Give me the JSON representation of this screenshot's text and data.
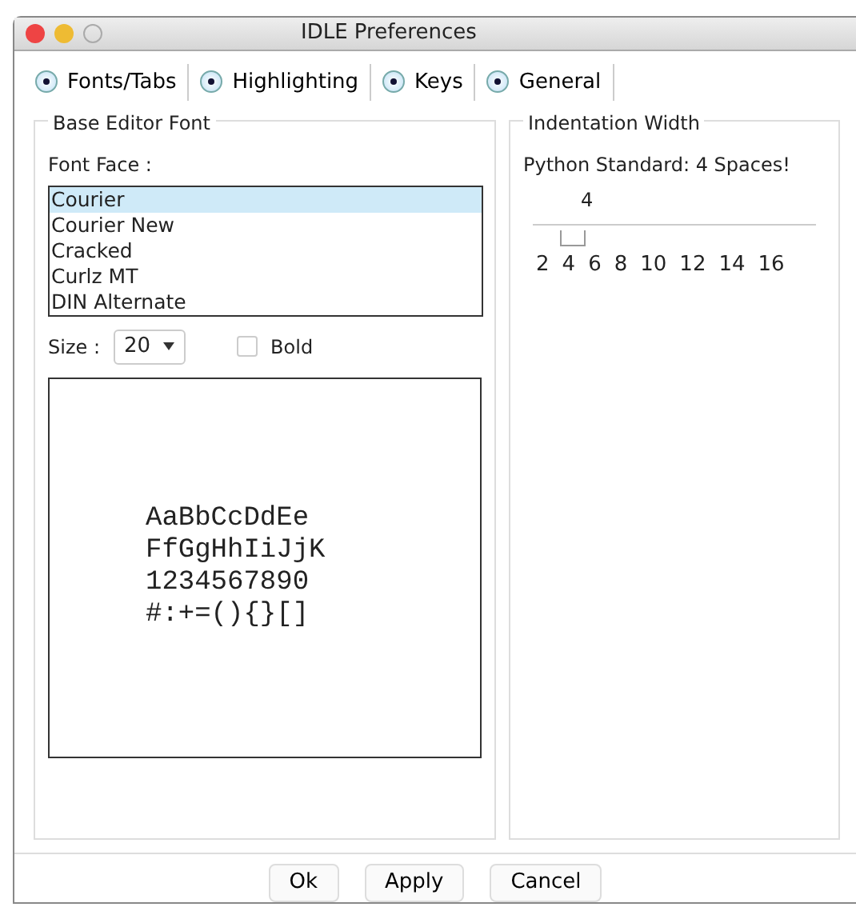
{
  "window": {
    "title": "IDLE Preferences"
  },
  "tabs": [
    {
      "label": "Fonts/Tabs",
      "checked": true
    },
    {
      "label": "Highlighting",
      "checked": true
    },
    {
      "label": "Keys",
      "checked": true
    },
    {
      "label": "General",
      "checked": true
    }
  ],
  "base_editor_font": {
    "title": "Base Editor Font",
    "font_face_label": "Font Face :",
    "fonts": [
      {
        "name": "Courier",
        "selected": true
      },
      {
        "name": "Courier New",
        "selected": false
      },
      {
        "name": "Cracked",
        "selected": false
      },
      {
        "name": "Curlz MT",
        "selected": false
      },
      {
        "name": "DIN Alternate",
        "selected": false
      }
    ],
    "size_label": "Size :",
    "size_value": "20",
    "bold": {
      "label": "Bold",
      "checked": false
    },
    "preview_lines": [
      "AaBbCcDdEe",
      "FfGgHhIiJjK",
      "1234567890",
      "#:+=(){}[]"
    ]
  },
  "indentation_width": {
    "title": "Indentation Width",
    "note": "Python Standard: 4 Spaces!",
    "value": "4",
    "level": 0.14,
    "tick_labels": [
      "2",
      "4",
      "6",
      "8",
      "10",
      "12",
      "14",
      "16"
    ]
  },
  "buttons": [
    "Ok",
    "Apply",
    "Cancel"
  ]
}
